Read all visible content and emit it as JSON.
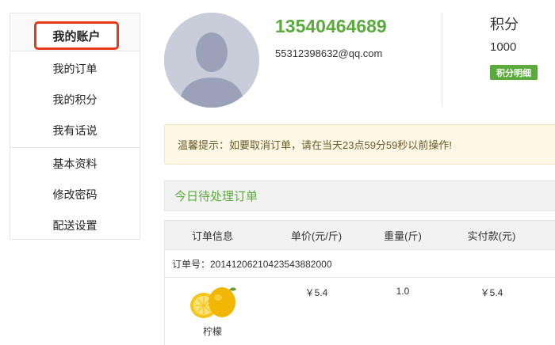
{
  "sidebar": {
    "title": "我的账户",
    "group1": [
      {
        "label": "我的订单"
      },
      {
        "label": "我的积分"
      },
      {
        "label": "我有话说"
      }
    ],
    "group2": [
      {
        "label": "基本资料"
      },
      {
        "label": "修改密码"
      },
      {
        "label": "配送设置"
      }
    ]
  },
  "profile": {
    "phone": "13540464689",
    "email": "55312398632@qq.com",
    "points_label": "积分",
    "points_value": "1000",
    "points_detail_button": "积分明细"
  },
  "notice": {
    "text": "温馨提示：如要取消订单，请在当天23点59分59秒以前操作!"
  },
  "orders": {
    "panel_title": "今日待处理订单",
    "columns": [
      "订单信息",
      "单价(元/斤)",
      "重量(斤)",
      "实付款(元)"
    ],
    "order_number_label": "订单号：20141206210423543882000",
    "items": [
      {
        "name": "柠檬",
        "unit_price": "￥5.4",
        "weight": "1.0",
        "paid": "￥5.4"
      }
    ]
  },
  "colors": {
    "accent_green": "#5aab3c",
    "highlight_red": "#e8381c",
    "notice_bg": "#fdf8e6"
  }
}
